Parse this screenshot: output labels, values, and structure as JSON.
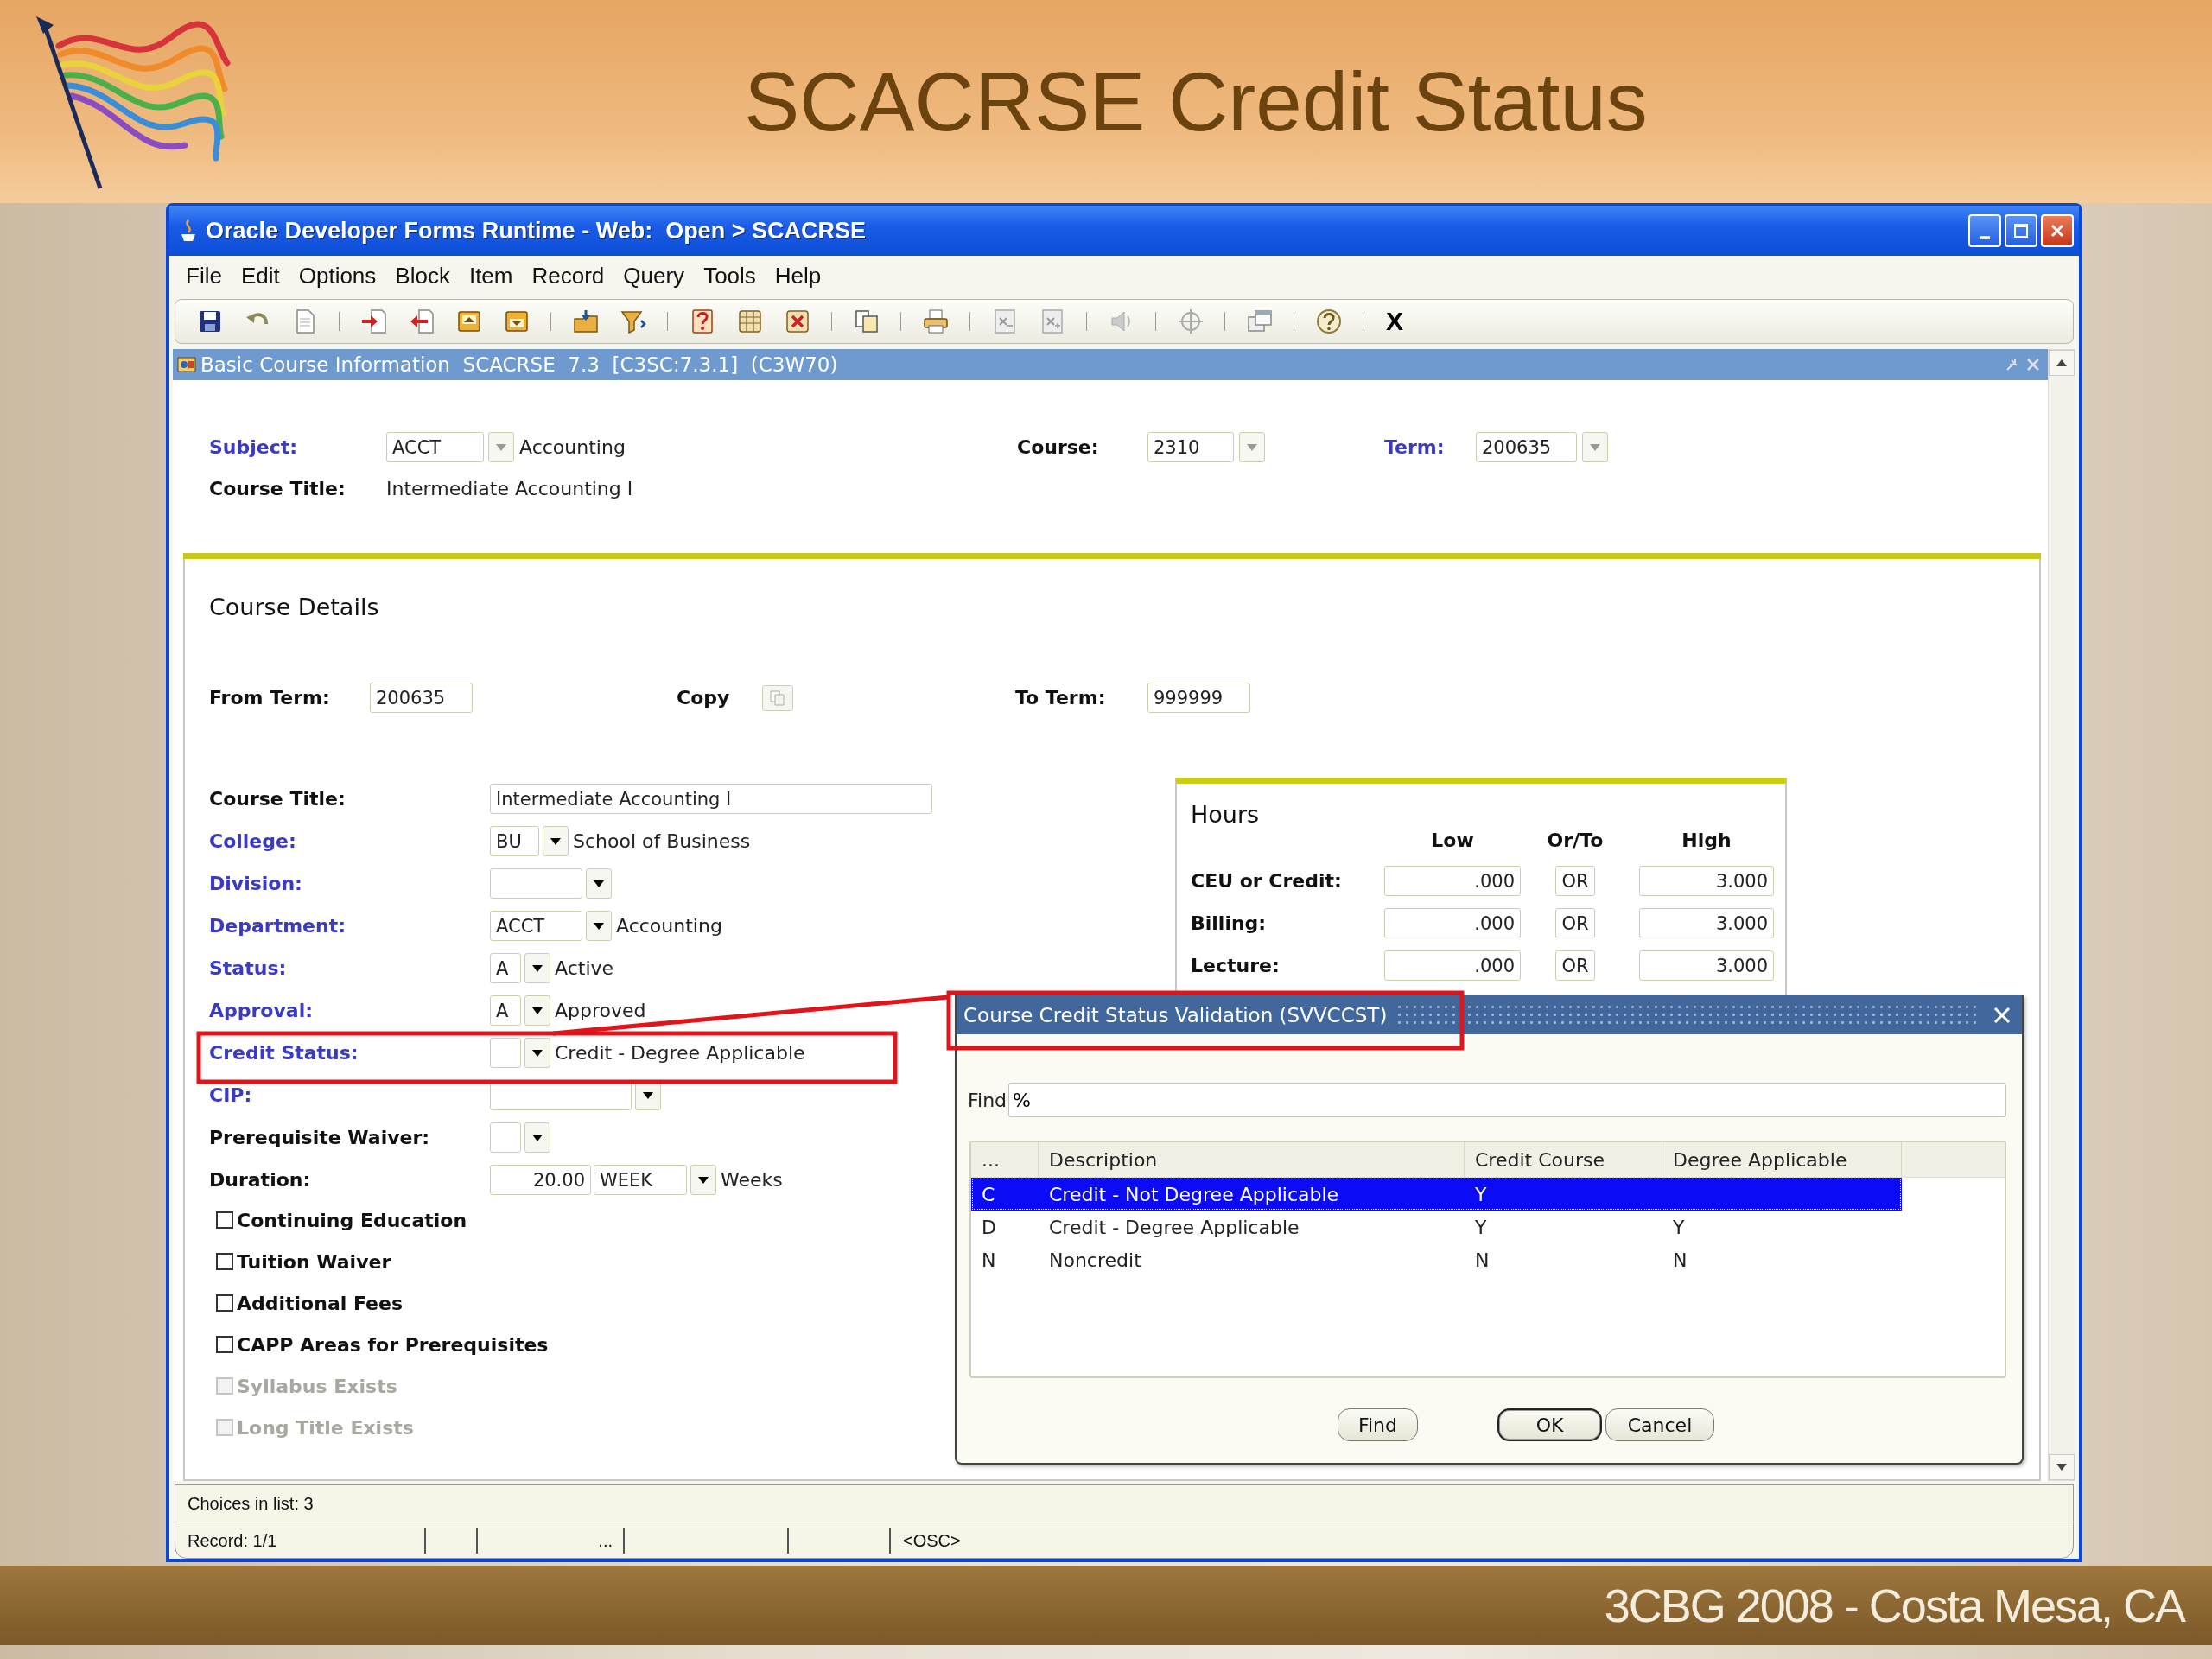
{
  "slide": {
    "title": "SCACRSE Credit Status",
    "footer": "3CBG 2008 - Costa Mesa, CA"
  },
  "window": {
    "title": "Oracle Developer Forms Runtime - Web:  Open > SCACRSE"
  },
  "menu": [
    "File",
    "Edit",
    "Options",
    "Block",
    "Item",
    "Record",
    "Query",
    "Tools",
    "Help"
  ],
  "toolbar": {
    "exit_label": "X"
  },
  "form": {
    "title": "Basic Course Information  SCACRSE  7.3  [C3SC:7.3.1]  (C3W70)"
  },
  "key_block": {
    "subject": {
      "label": "Subject:",
      "required": true,
      "code": "ACCT",
      "description": "Accounting"
    },
    "course": {
      "label": "Course:",
      "required": false,
      "value": "2310"
    },
    "term": {
      "label": "Term:",
      "required": true,
      "value": "200635"
    },
    "course_title": {
      "label": "Course Title:",
      "required": false,
      "value": "Intermediate Accounting I"
    }
  },
  "details": {
    "heading": "Course Details",
    "from_term": {
      "label": "From Term:",
      "value": "200635"
    },
    "copy": {
      "label": "Copy"
    },
    "to_term": {
      "label": "To Term:",
      "value": "999999"
    },
    "fields": [
      {
        "kind": "text",
        "label": "Course Title:",
        "required": false,
        "value": "Intermediate Accounting I"
      },
      {
        "kind": "lookup",
        "label": "College:",
        "required": true,
        "code": "BU",
        "description": "School of Business"
      },
      {
        "kind": "lookup",
        "label": "Division:",
        "required": true
      },
      {
        "kind": "lookup",
        "label": "Department:",
        "required": true,
        "code": "ACCT",
        "description": "Accounting"
      },
      {
        "kind": "lookup",
        "label": "Status:",
        "required": true,
        "code": "A",
        "description": "Active"
      },
      {
        "kind": "lookup",
        "label": "Approval:",
        "required": true,
        "code": "A",
        "description": "Approved"
      },
      {
        "kind": "lookup",
        "label": "Credit Status:",
        "required": true,
        "description": "Credit - Degree Applicable"
      },
      {
        "kind": "lookup",
        "label": "CIP:",
        "required": true
      },
      {
        "kind": "lookup",
        "label": "Prerequisite Waiver:",
        "required": false
      },
      {
        "kind": "duration",
        "label": "Duration:",
        "required": false,
        "value": "20.00",
        "unit": "WEEK",
        "description": "Weeks"
      }
    ],
    "checkboxes": [
      {
        "label": "Continuing Education",
        "checked": false,
        "disabled": false
      },
      {
        "label": "Tuition Waiver",
        "checked": false,
        "disabled": false
      },
      {
        "label": "Additional Fees",
        "checked": false,
        "disabled": false
      },
      {
        "label": "CAPP Areas for Prerequisites",
        "checked": false,
        "disabled": false
      },
      {
        "label": "Syllabus Exists",
        "checked": false,
        "disabled": true
      },
      {
        "label": "Long Title Exists",
        "checked": false,
        "disabled": true
      }
    ]
  },
  "hours": {
    "title": "Hours",
    "columns": [
      "Low",
      "Or/To",
      "High"
    ],
    "rows": [
      {
        "label": "CEU or Credit:",
        "low": ".000",
        "or_to": "OR",
        "high": "3.000"
      },
      {
        "label": "Billing:",
        "low": ".000",
        "or_to": "OR",
        "high": "3.000"
      },
      {
        "label": "Lecture:",
        "low": ".000",
        "or_to": "OR",
        "high": "3.000"
      }
    ]
  },
  "dialog": {
    "title": "Course Credit Status Validation (SVVCCST)",
    "find_label": "Find",
    "find_value": "%",
    "columns": [
      "...",
      "Description",
      "Credit Course",
      "Degree Applicable"
    ],
    "rows": [
      {
        "code": "C",
        "description": "Credit - Not Degree Applicable",
        "credit_course": "Y",
        "selected": true
      },
      {
        "code": "D",
        "description": "Credit - Degree Applicable",
        "credit_course": "Y",
        "degree_applicable": "Y",
        "selected": false
      },
      {
        "code": "N",
        "description": "Noncredit",
        "credit_course": "N",
        "degree_applicable": "N",
        "selected": false
      }
    ],
    "buttons": [
      {
        "label": "Find",
        "default": false
      },
      {
        "label": "OK",
        "default": true
      },
      {
        "label": "Cancel",
        "default": false
      }
    ]
  },
  "status_bar": {
    "message": "Choices in list: 3",
    "record": "Record: 1/1",
    "ellipsis": "...",
    "mode": "<OSC>"
  }
}
